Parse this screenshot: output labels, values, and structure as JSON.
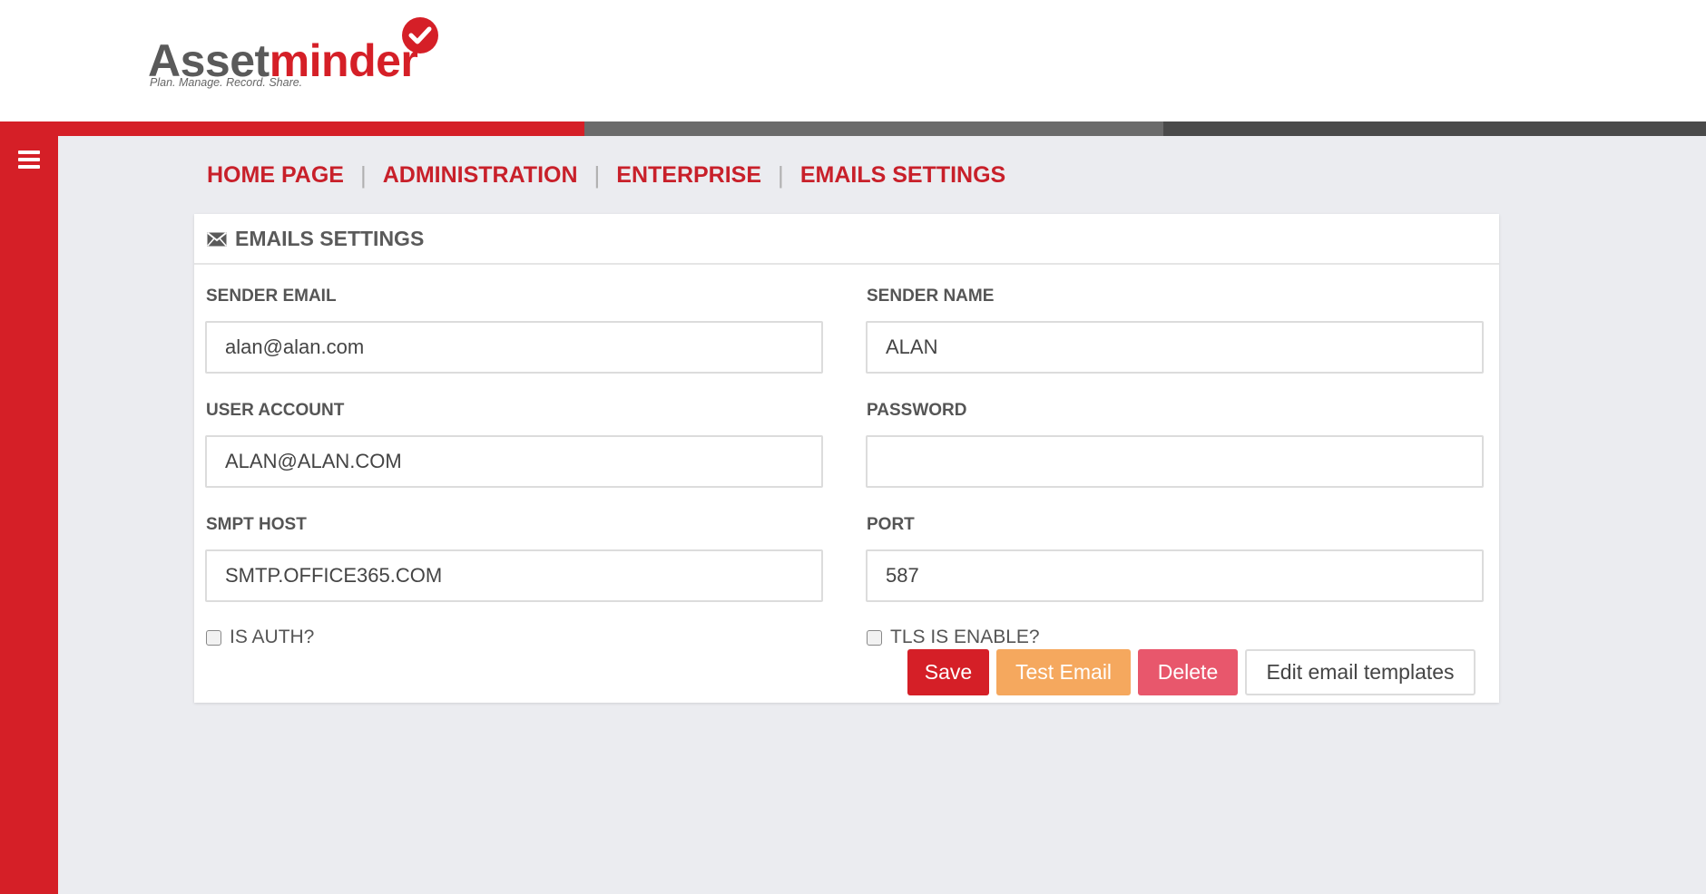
{
  "app": {
    "brand_part1": "Asset",
    "brand_part2": "minder",
    "tagline": "Plan. Manage. Record. Share."
  },
  "breadcrumb": [
    "HOME PAGE",
    "ADMINISTRATION",
    "ENTERPRISE",
    "EMAILS SETTINGS"
  ],
  "panel": {
    "title": "EMAILS SETTINGS",
    "icon": "envelope-icon"
  },
  "form": {
    "sender_email": {
      "label": "SENDER EMAIL",
      "value": "alan@alan.com"
    },
    "sender_name": {
      "label": "SENDER NAME",
      "value": "ALAN"
    },
    "user_account": {
      "label": "USER ACCOUNT",
      "value": "ALAN@ALAN.COM"
    },
    "password": {
      "label": "PASSWORD",
      "value": ""
    },
    "smtp_host": {
      "label": "SMPT HOST",
      "value": "SMTP.OFFICE365.COM"
    },
    "port": {
      "label": "PORT",
      "value": "587"
    },
    "is_auth": {
      "label": "IS AUTH?",
      "checked": false
    },
    "tls_enable": {
      "label": "TLS IS ENABLE?",
      "checked": false
    }
  },
  "buttons": {
    "save": "Save",
    "test_email": "Test Email",
    "delete": "Delete",
    "edit_templates": "Edit email templates"
  },
  "colors": {
    "brand_red": "#d51f27",
    "test_orange": "#f5a85e",
    "delete_pink": "#e8576c",
    "background": "#ebecf0"
  }
}
